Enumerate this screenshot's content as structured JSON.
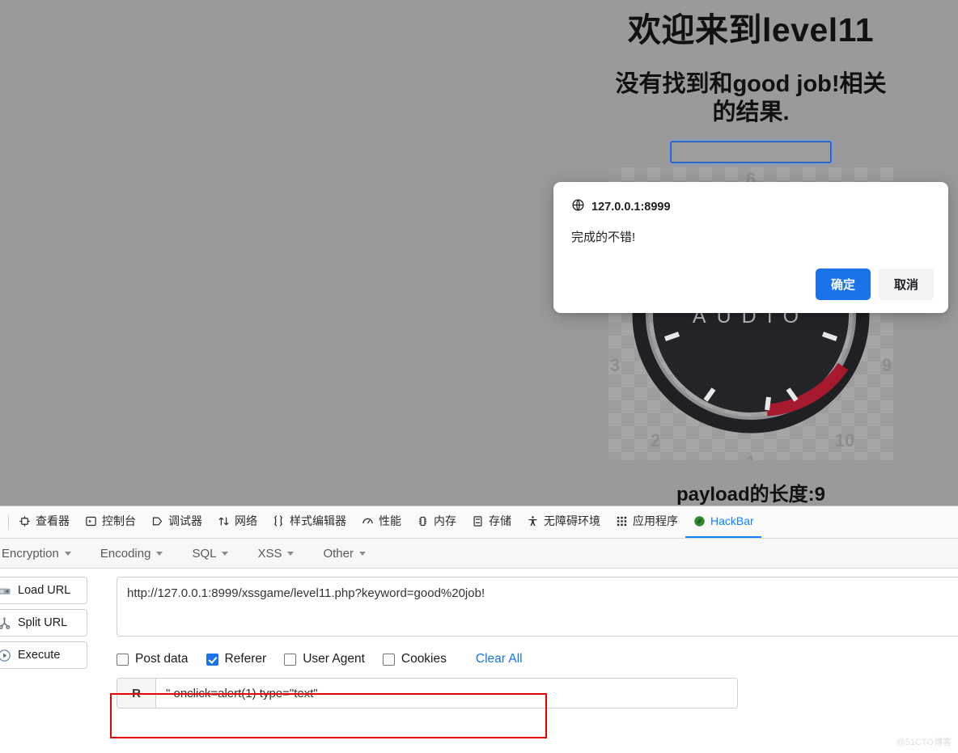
{
  "page": {
    "heading": "欢迎来到level11",
    "subheading": "没有找到和good job!相关的结果.",
    "search_input_value": "",
    "search_input_placeholder": "",
    "payload_length_text": "payload的长度:9",
    "image_alt": "audio-gauge"
  },
  "dialog": {
    "origin": "127.0.0.1:8999",
    "message": "完成的不错!",
    "confirm_label": "确定",
    "cancel_label": "取消",
    "globe_icon": "globe-icon",
    "confirm_color": "#1a73e8",
    "cancel_color": "#f1f3f4"
  },
  "devtools": {
    "tabs": [
      {
        "label": "查看器",
        "icon": "inspector-icon",
        "active": false
      },
      {
        "label": "控制台",
        "icon": "console-icon",
        "active": false
      },
      {
        "label": "调试器",
        "icon": "debugger-icon",
        "active": false
      },
      {
        "label": "网络",
        "icon": "network-icon",
        "active": false
      },
      {
        "label": "样式编辑器",
        "icon": "style-editor-icon",
        "active": false
      },
      {
        "label": "性能",
        "icon": "performance-icon",
        "active": false
      },
      {
        "label": "内存",
        "icon": "memory-icon",
        "active": false
      },
      {
        "label": "存储",
        "icon": "storage-icon",
        "active": false
      },
      {
        "label": "无障碍环境",
        "icon": "accessibility-icon",
        "active": false
      },
      {
        "label": "应用程序",
        "icon": "application-icon",
        "active": false
      },
      {
        "label": "HackBar",
        "icon": "hackbar-icon",
        "active": true
      }
    ],
    "active_tab_color": "#0a84ff"
  },
  "hackbar": {
    "menu": [
      {
        "label": "Encryption"
      },
      {
        "label": "Encoding"
      },
      {
        "label": "SQL"
      },
      {
        "label": "XSS"
      },
      {
        "label": "Other"
      }
    ],
    "buttons": [
      {
        "label": "Load URL",
        "icon": "load-url-icon"
      },
      {
        "label": "Split URL",
        "icon": "split-url-icon"
      },
      {
        "label": "Execute",
        "icon": "execute-icon"
      }
    ],
    "url_value": "http://127.0.0.1:8999/xssgame/level11.php?keyword=good%20job!",
    "url_placeholder": "",
    "checkboxes": [
      {
        "label": "Post data",
        "checked": false
      },
      {
        "label": "Referer",
        "checked": true
      },
      {
        "label": "User Agent",
        "checked": false
      },
      {
        "label": "Cookies",
        "checked": false
      }
    ],
    "clear_all_label": "Clear All",
    "referer_prefix": "R",
    "referer_value": "\" onclick=alert(1) type=\"text\"",
    "referer_placeholder": "",
    "highlight_color": "#e60000"
  },
  "watermark": "@51CTO博客"
}
